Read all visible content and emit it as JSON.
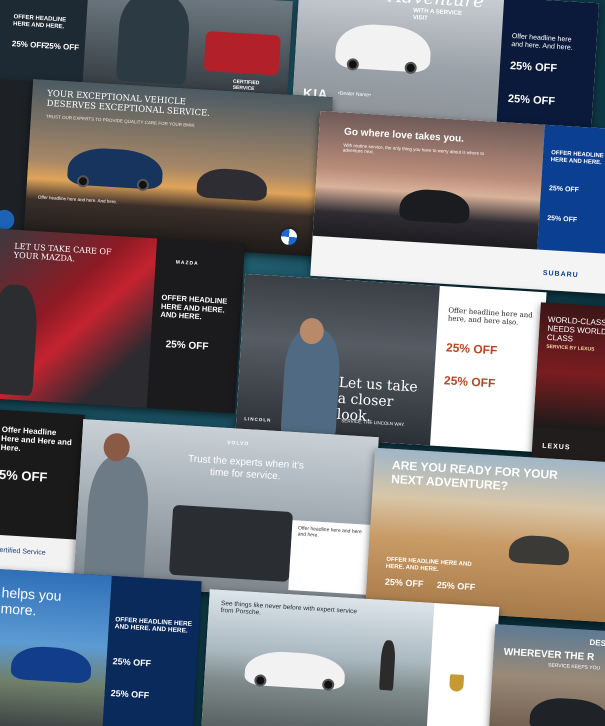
{
  "cards": {
    "chevy": {
      "offer_headline": "OFFER HEADLINE HERE AND HERE.",
      "offer_1": "25% OFF",
      "offer_2": "25% OFF",
      "brand": "CERTIFIED SERVICE",
      "colors": {
        "panel": "#1e2a33"
      }
    },
    "kia": {
      "script_headline": "Adventure",
      "subtitle": "WITH A SERVICE VISIT",
      "offer_headline": "Offer headline here and here. And here.",
      "offer_1": "25% OFF",
      "offer_2": "25% OFF",
      "brand": "KIA",
      "dealer": "•Dealer Name•",
      "colors": {
        "panel": "#0b1a3b"
      }
    },
    "bmw": {
      "headline": "YOUR EXCEPTIONAL VEHICLE DESERVES EXCEPTIONAL SERVICE.",
      "subhead": "TRUST OUR EXPERTS TO PROVIDE QUALITY CARE FOR YOUR BMW.",
      "offer_headline": "Offer headline here and here. And here.",
      "brand": "BMW"
    },
    "subaru": {
      "headline": "Go where love takes you.",
      "subhead": "With routine service, the only thing you have to worry about is where to adventure next.",
      "offer_headline": "OFFER HEADLINE HERE AND HERE.",
      "offer_1": "25% OFF",
      "offer_2": "25% OFF",
      "brand": "SUBARU",
      "colors": {
        "panel": "#0a3f91"
      }
    },
    "mazda": {
      "headline": "LET US TAKE CARE OF YOUR MAZDA.",
      "offer_headline": "OFFER HEADLINE HERE AND HERE. AND HERE.",
      "offer_1": "25% OFF",
      "brand": "MAZDA",
      "colors": {
        "panel": "#1b1b1d"
      }
    },
    "lincoln": {
      "headline": "Let us take a closer look.",
      "tagline": "SERVICE. THE LINCOLN WAY.",
      "offer_headline": "Offer headline here and here, and here also.",
      "offer_1": "25% OFF",
      "offer_2": "25% OFF",
      "brand": "LINCOLN"
    },
    "lexus": {
      "headline": "WORLD-CLASS NEEDS WORLD-CLASS",
      "subhead": "SERVICE BY LEXUS",
      "brand": "LEXUS"
    },
    "left_offer": {
      "offer_headline": "Offer Headline Here and Here and Here.",
      "offer_1": "5% OFF",
      "footer": "Certified Service"
    },
    "volvo": {
      "brand": "VOLVO",
      "headline": "Trust the experts when it's time for service.",
      "offer_headline": "Offer headline here and here and here."
    },
    "adventure": {
      "headline": "ARE YOU READY FOR YOUR NEXT ADVENTURE?",
      "offer_headline": "OFFER HEADLINE HERE AND HERE. AND HERE.",
      "offer_1": "25% OFF",
      "offer_2": "25% OFF"
    },
    "vw": {
      "headline": "helps you more.",
      "offer_headline": "OFFER HEADLINE HERE AND HERE. AND HERE.",
      "offer_1": "25% OFF",
      "offer_2": "25% OFF",
      "colors": {
        "panel": "#0b2a5c"
      }
    },
    "porsche": {
      "headline": "See things like never before with expert service from Porsche.",
      "brand": "PORSCHE"
    },
    "land": {
      "headline_1": "DESTI",
      "headline_2": "WHEREVER THE R",
      "subhead": "SERVICE KEEPS YOU"
    }
  }
}
